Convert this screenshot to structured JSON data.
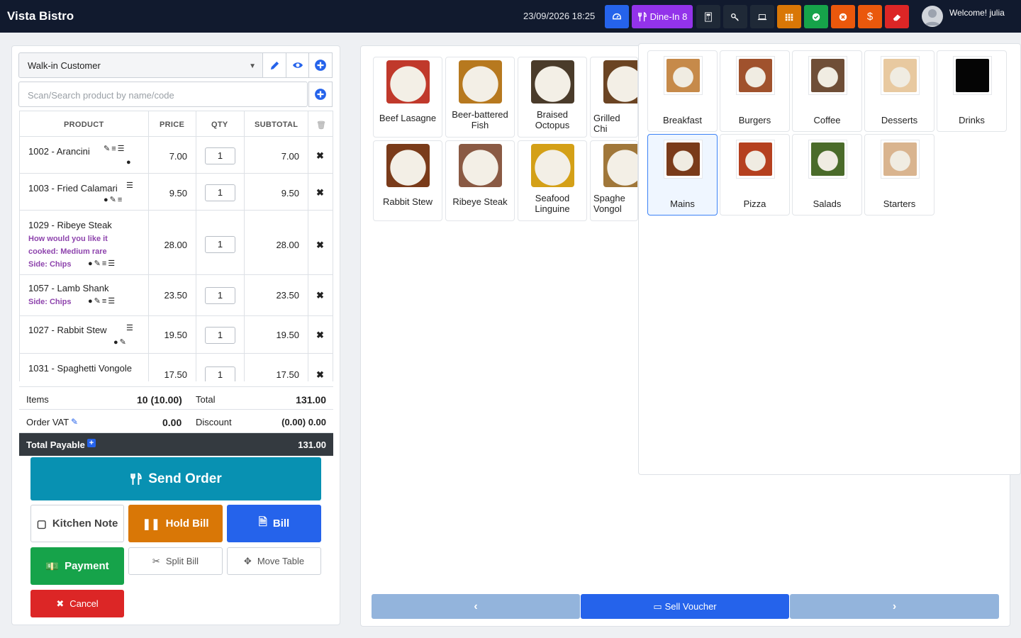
{
  "app": {
    "title": "Vista Bistro",
    "datetime": "23/09/2026 18:25",
    "welcome": "Welcome! julia"
  },
  "toolbar": {
    "dinein_label": "Dine-In 8"
  },
  "customer": {
    "selected": "Walk-in Customer"
  },
  "search": {
    "placeholder": "Scan/Search product by name/code"
  },
  "table": {
    "headers": {
      "product": "PRODUCT",
      "price": "PRICE",
      "qty": "QTY",
      "subtotal": "SUBTOTAL"
    },
    "rows": [
      {
        "name": "1002 - Arancini",
        "price": "7.00",
        "qty": "1",
        "subtotal": "7.00"
      },
      {
        "name": "1003 - Fried Calamari",
        "price": "9.50",
        "qty": "1",
        "subtotal": "9.50"
      },
      {
        "name": "1029 - Ribeye Steak",
        "mod1": "How would you like it",
        "mod2": "cooked: Medium rare",
        "mod3": "Side: Chips",
        "price": "28.00",
        "qty": "1",
        "subtotal": "28.00"
      },
      {
        "name": "1057 - Lamb Shank",
        "mod1": "Side: Chips",
        "price": "23.50",
        "qty": "1",
        "subtotal": "23.50"
      },
      {
        "name": "1027 - Rabbit Stew",
        "price": "19.50",
        "qty": "1",
        "subtotal": "19.50"
      },
      {
        "name": "1031 - Spaghetti Vongole",
        "price": "17.50",
        "qty": "1",
        "subtotal": "17.50"
      }
    ]
  },
  "summary": {
    "items_label": "Items",
    "items_value": "10 (10.00)",
    "total_label": "Total",
    "total_value": "131.00",
    "vat_label": "Order VAT",
    "vat_value": "0.00",
    "discount_label": "Discount",
    "discount_value": "(0.00) 0.00",
    "payable_label": "Total Payable",
    "payable_value": "131.00"
  },
  "actions": {
    "send": "Send Order",
    "kitchen": "Kitchen Note",
    "hold": "Hold Bill",
    "bill": "Bill",
    "payment": "Payment",
    "split": "Split Bill",
    "move": "Move Table",
    "cancel": "Cancel"
  },
  "products": [
    {
      "name": "Beef Lasagne",
      "color": "#c0392b"
    },
    {
      "name": "Beer-battered Fish",
      "color": "#b7791f"
    },
    {
      "name": "Braised Octopus",
      "color": "#4a3b2a"
    },
    {
      "name": "Grilled Chi",
      "color": "#6b4423"
    },
    {
      "name": "Rabbit Stew",
      "color": "#7a3b1a"
    },
    {
      "name": "Ribeye Steak",
      "color": "#8a5a44"
    },
    {
      "name": "Seafood Linguine",
      "color": "#d4a017"
    },
    {
      "name": "Spaghe Vongol",
      "color": "#a0773a"
    }
  ],
  "categories": [
    {
      "name": "Breakfast",
      "color": "#c68a4a"
    },
    {
      "name": "Burgers",
      "color": "#a0522d"
    },
    {
      "name": "Coffee",
      "color": "#6f4e37"
    },
    {
      "name": "Desserts",
      "color": "#e8c9a0"
    },
    {
      "name": "Drinks",
      "color": "#0a0a0a"
    },
    {
      "name": "Mains",
      "color": "#7a3b1a"
    },
    {
      "name": "Pizza",
      "color": "#b5401f"
    },
    {
      "name": "Salads",
      "color": "#4a6b2a"
    },
    {
      "name": "Starters",
      "color": "#d9b48f"
    }
  ],
  "selected_category": "Mains",
  "bottom": {
    "voucher": "Sell Voucher"
  }
}
